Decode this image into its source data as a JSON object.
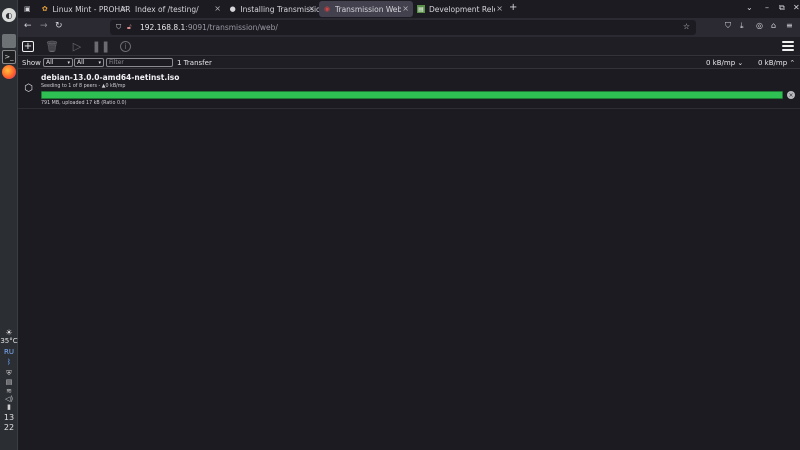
{
  "taskbar": {
    "icons": [
      "mint-menu-icon",
      "files-icon",
      "terminal-icon",
      "firefox-icon"
    ],
    "weather": "35°C",
    "keyboard_layout": "RU",
    "clock_hour": "13",
    "clock_minute": "22"
  },
  "browser": {
    "tabs": [
      {
        "label": "Linux Mint - PROHARD",
        "icon": "mint-leaf-icon"
      },
      {
        "label": "Index of /testing/",
        "icon": "none"
      },
      {
        "label": "Installing Transmission",
        "icon": "github-icon"
      },
      {
        "label": "Transmission Web Int",
        "icon": "transmission-icon",
        "active": true
      },
      {
        "label": "Development Release",
        "icon": "page-icon"
      }
    ],
    "new_tab": "+",
    "url_host": "192.168.8.1",
    "url_rest": ":9091/transmission/web/"
  },
  "toolbar": {
    "open_icon": "add-torrent-icon",
    "remove_icon": "trash-icon",
    "start_icon": "play-icon",
    "pause_icon": "pause-icon",
    "info_icon": "info-icon",
    "menu_icon": "hamburger-menu-icon"
  },
  "filter": {
    "show_label": "Show",
    "status_value": "All",
    "tracker_value": "All",
    "filter_placeholder": "Filter",
    "transfer_count": "1 Transfer",
    "download_speed": "0 kB/mp",
    "upload_speed": "0 kB/mp"
  },
  "torrents": [
    {
      "name": "debian-13.0.0-amd64-netinst.iso",
      "peers": "Seeding to 1 of 8 peers - ▲0 kB/mp",
      "progress": 1.0,
      "stats": "791 MB, uploaded 17 kB (Ratio 0.0)"
    }
  ],
  "colors": {
    "progress_seed": "#2ec052",
    "background": "#1c1b22"
  }
}
